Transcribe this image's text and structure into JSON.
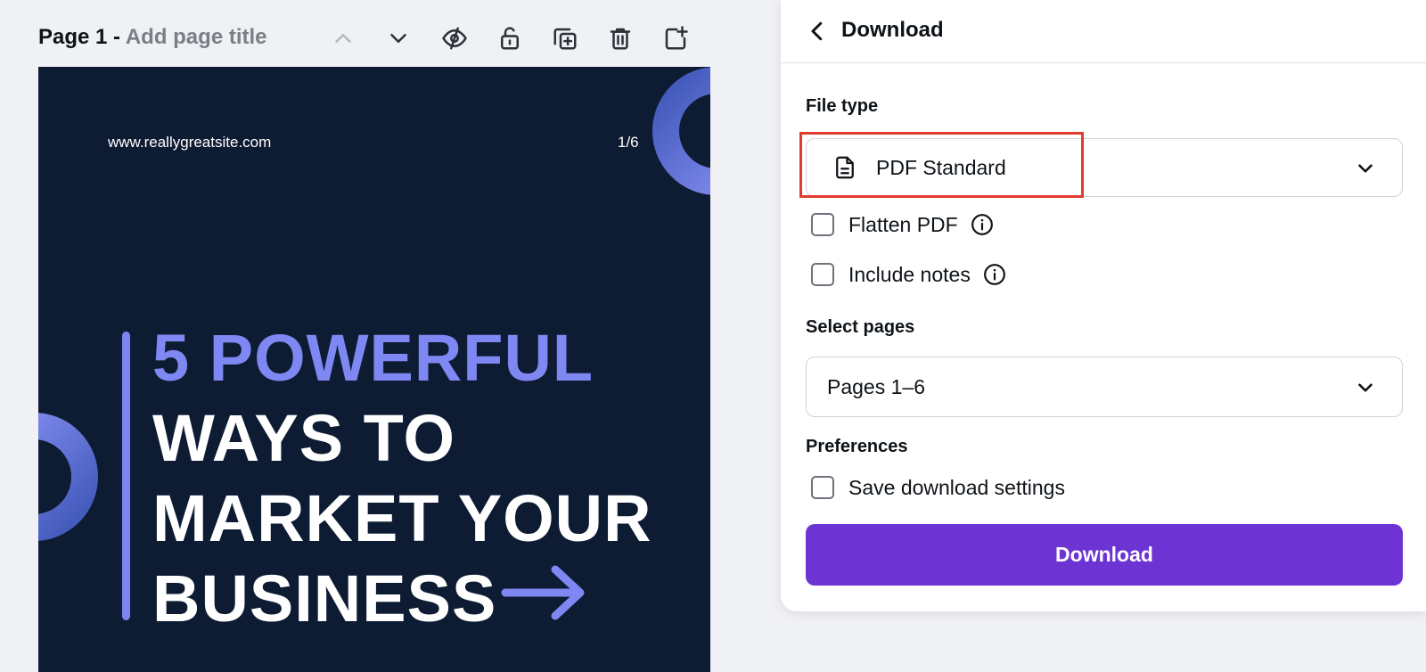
{
  "page_header": {
    "prefix": "Page 1 - ",
    "title_placeholder": "Add page title",
    "icons": [
      "chevron-up-icon",
      "chevron-down-icon",
      "eye-slash-icon",
      "unlock-icon",
      "duplicate-icon",
      "trash-icon",
      "add-page-icon"
    ]
  },
  "slide": {
    "url": "www.reallygreatsite.com",
    "pager": "1/6",
    "headline_accent": "5 POWERFUL",
    "headline_lines": [
      "WAYS TO",
      "MARKET YOUR",
      "BUSINESS"
    ],
    "colors": {
      "background": "#0d1b33",
      "accent": "#7f88f2"
    }
  },
  "panel": {
    "title": "Download",
    "file_type": {
      "label": "File type",
      "value": "PDF Standard",
      "icon": "document-icon"
    },
    "options": [
      {
        "label": "Flatten PDF",
        "checked": false,
        "has_info": true
      },
      {
        "label": "Include notes",
        "checked": false,
        "has_info": true
      }
    ],
    "select_pages": {
      "label": "Select pages",
      "value": "Pages 1–6"
    },
    "preferences": {
      "label": "Preferences",
      "save_settings": {
        "label": "Save download settings",
        "checked": false
      }
    },
    "download_button": "Download",
    "colors": {
      "button": "#6d34d3",
      "highlight": "#e23b2e"
    }
  }
}
